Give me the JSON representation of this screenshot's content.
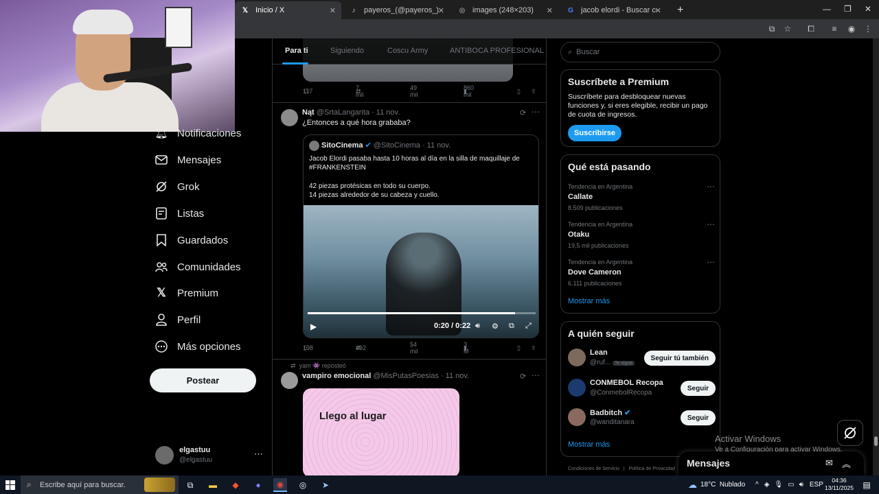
{
  "browser": {
    "tabs": [
      {
        "title": "Inicio / X",
        "favicon": "x-logo-icon"
      },
      {
        "title": "payeros_(@payeros_) | TikTok",
        "favicon": "tiktok-icon"
      },
      {
        "title": "images (248×203)",
        "favicon": "globe-icon"
      },
      {
        "title": "jacob elordi - Buscar con Goog",
        "favicon": "google-icon"
      }
    ]
  },
  "nav": {
    "items": [
      {
        "label": "Notificaciones",
        "icon": "bell-icon"
      },
      {
        "label": "Mensajes",
        "icon": "envelope-icon"
      },
      {
        "label": "Grok",
        "icon": "grok-icon"
      },
      {
        "label": "Listas",
        "icon": "list-icon"
      },
      {
        "label": "Guardados",
        "icon": "bookmark-icon"
      },
      {
        "label": "Comunidades",
        "icon": "people-icon"
      },
      {
        "label": "Premium",
        "icon": "x-logo-icon"
      },
      {
        "label": "Perfil",
        "icon": "person-icon"
      },
      {
        "label": "Más opciones",
        "icon": "more-circle-icon"
      }
    ],
    "post_button": "Postear",
    "account": {
      "name": "elgastuu",
      "handle": "@elgastuu"
    }
  },
  "timeline": {
    "tabs": [
      "Para ti",
      "Siguiendo",
      "Coscu Army",
      "ANTIBOCA PROFESIONAL"
    ],
    "post1_actions": {
      "replies": "117",
      "reposts": "7 mil",
      "likes": "49 mil",
      "views": "860 mil"
    },
    "post2": {
      "author": "Nąt",
      "handle": "@SrtaLangarita",
      "date": "· 11 nov.",
      "text": "¿Entonces a qué hora grababa?",
      "quote": {
        "author": "SitoCinema",
        "handle": "@SitoCinema",
        "date": "· 11 nov.",
        "line1": "Jacob Elordi pasaba hasta 10 horas al día en la silla de maquillaje de",
        "line2": "#FRANKENSTEIN",
        "line3": "42 piezas protésicas en todo su cuerpo.",
        "line4": "14 piezas alrededor de su cabeza y cuello."
      },
      "video": {
        "time": "0:20 / 0:22",
        "progress": 0.91
      },
      "actions": {
        "replies": "108",
        "reposts": "492",
        "likes": "54 mil",
        "views": "3 M"
      }
    },
    "post3": {
      "repost_label": "yam 👾 reposteó",
      "author": "vampiro emocional",
      "handle": "@MisPutasPoesias",
      "date": "· 11 nov.",
      "image_text": "Llego al lugar"
    }
  },
  "sidebar": {
    "search_placeholder": "Buscar",
    "premium": {
      "title": "Suscríbete a Premium",
      "body": "Suscríbete para desbloquear nuevas funciones y, si eres elegible, recibir un pago de cuota de ingresos.",
      "button": "Suscribirse"
    },
    "trends": {
      "title": "Qué está pasando",
      "items": [
        {
          "meta": "Tendencia en Argentina",
          "name": "Callate",
          "count": "8.509 publicaciones"
        },
        {
          "meta": "Tendencia en Argentina",
          "name": "Otaku",
          "count": "19,5 mil publicaciones"
        },
        {
          "meta": "Tendencia en Argentina",
          "name": "Dove Cameron",
          "count": "6.111 publicaciones"
        }
      ],
      "more": "Mostrar más"
    },
    "follow": {
      "title": "A quién seguir",
      "items": [
        {
          "name": "Lean",
          "handle": "@ruf...",
          "badge": "Te sigue",
          "button": "Seguir tú también"
        },
        {
          "name": "CONMEBOL Recopa",
          "handle": "@ConmebolRecopa",
          "button": "Seguir"
        },
        {
          "name": "Badbitch",
          "handle": "@wanditanara",
          "button": "Seguir"
        }
      ],
      "more": "Mostrar más"
    },
    "footer": "Condiciones de Servicio   |   Política de Privacidad"
  },
  "messages_drawer": "Mensajes",
  "windows_watermark": {
    "line1": "Activar Windows",
    "line2": "Ve a Configuración para activar Windows."
  },
  "taskbar": {
    "search_placeholder": "Escribe aquí para buscar.",
    "weather": "18°C  Nublado",
    "lang": "ESP",
    "time": "04:36",
    "date": "13/11/2025"
  }
}
